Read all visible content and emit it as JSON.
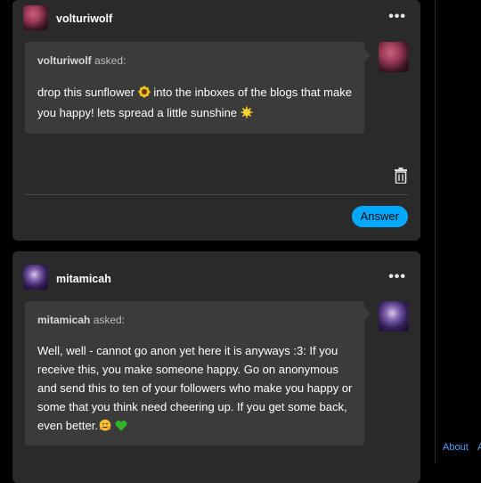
{
  "posts": [
    {
      "blog": "volturiwolf",
      "more": "•••",
      "asker": "volturiwolf",
      "asked_suffix": " asked:",
      "question_parts": [
        "drop this sunflower ",
        " into the inboxes of the blogs that make you happy! lets spread a little sunshine "
      ],
      "answer_label": "Answer"
    },
    {
      "blog": "mitamicah",
      "more": "•••",
      "asker": "mitamicah",
      "asked_suffix": " asked:",
      "question_text": "Well, well - cannot go anon yet here it is anyways :3: If you receive this, you make someone happy. Go on anonymous and send this to ten of your followers who make you happy or some that you think need cheering up. If you get some back, even better."
    }
  ],
  "footer": {
    "about": "About",
    "next": "A"
  },
  "colors": {
    "accent": "#00a8ff",
    "card": "#2a2a2a",
    "ask_bubble": "#3b3b3b",
    "link": "#4aa3ff"
  },
  "icons": [
    "sunflower-emoji",
    "sun-emoji",
    "trash-icon",
    "hug-emoji",
    "green-heart-emoji",
    "more-icon"
  ]
}
